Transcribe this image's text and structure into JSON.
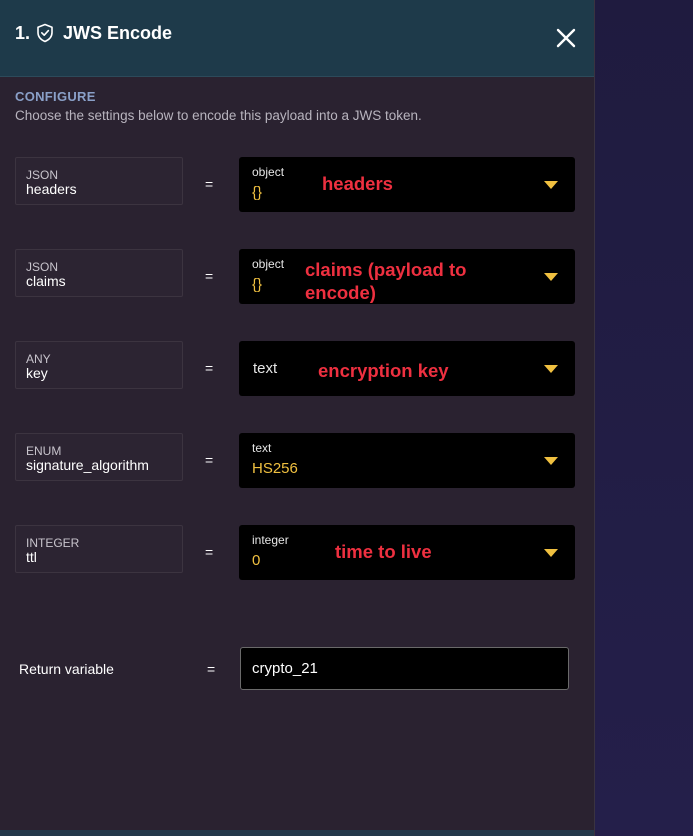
{
  "header": {
    "step_number": "1.",
    "title": "JWS Encode",
    "icons": {
      "shield": "shield-check-icon",
      "close": "close-icon"
    }
  },
  "configure": {
    "label": "CONFIGURE",
    "description": "Choose the settings below to encode this payload into a JWS token."
  },
  "params": [
    {
      "type": "JSON",
      "name": "headers",
      "value_type": "object",
      "value": "{}",
      "annotation": "headers"
    },
    {
      "type": "JSON",
      "name": "claims",
      "value_type": "object",
      "value": "{}",
      "annotation": "claims (payload to encode)"
    },
    {
      "type": "ANY",
      "name": "key",
      "value_type": "text",
      "value": "",
      "annotation": "encryption key"
    },
    {
      "type": "ENUM",
      "name": "signature_algorithm",
      "value_type": "text",
      "value": "HS256",
      "annotation": ""
    },
    {
      "type": "INTEGER",
      "name": "ttl",
      "value_type": "integer",
      "value": "0",
      "annotation": "time to live"
    }
  ],
  "equals": "=",
  "return_variable": {
    "label": "Return variable",
    "value": "crypto_21"
  },
  "colors": {
    "header_bg": "#1e3a4a",
    "panel_bg": "#2a2230",
    "value_text": "#f0c040",
    "annotation": "#ee3040",
    "caret": "#f0c040"
  }
}
